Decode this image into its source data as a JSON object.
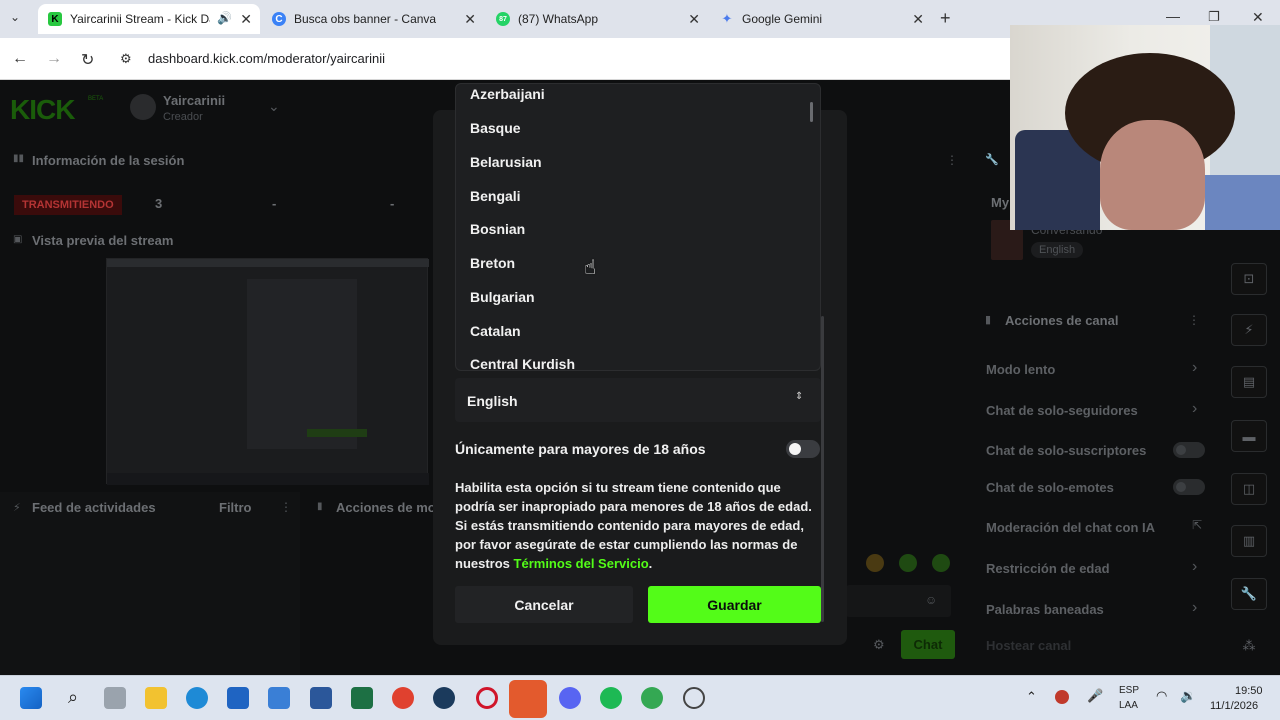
{
  "browser": {
    "tabs": [
      {
        "label": "Yaircarinii Stream - Kick Dashboard",
        "color": "#28c840",
        "glyph": "K"
      },
      {
        "label": "Busca obs banner - Canva",
        "color": "#3b82f6",
        "glyph": "C"
      },
      {
        "label": "(87) WhatsApp",
        "color": "#25d366",
        "glyph": "87"
      },
      {
        "label": "Google Gemini",
        "color": "#ffffff",
        "glyph": "✦"
      }
    ],
    "url": "dashboard.kick.com/moderator/yaircarinii"
  },
  "dashboard": {
    "logo": "KICK",
    "beta": "BETA",
    "channel_name": "Yaircarinii",
    "channel_role": "Creador",
    "session_title": "Información de la sesión",
    "live_badge": "TRANSMITIENDO",
    "viewers": "3",
    "dash1": "-",
    "dash2": "-",
    "preview_title": "Vista previa del stream",
    "feed_title": "Feed de actividades",
    "feed_filter": "Filtro",
    "mod_actions_title": "Acciones de mo",
    "chat_button": "Chat",
    "my_label": "My",
    "stream_category": "Conversando",
    "stream_language": "English",
    "channel_actions_title": "Acciones de canal",
    "channel_actions": [
      {
        "label": "Modo lento",
        "control": "chevron"
      },
      {
        "label": "Chat de solo-seguidores",
        "control": "chevron"
      },
      {
        "label": "Chat de solo-suscriptores",
        "control": "toggle"
      },
      {
        "label": "Chat de solo-emotes",
        "control": "toggle"
      },
      {
        "label": "Moderación del chat con IA",
        "control": "external"
      },
      {
        "label": "Restricción de edad",
        "control": "chevron"
      },
      {
        "label": "Palabras baneadas",
        "control": "chevron"
      },
      {
        "label": "Hostear canal",
        "control": "none"
      }
    ]
  },
  "modal": {
    "language_options": [
      "Azerbaijani",
      "Basque",
      "Belarusian",
      "Bengali",
      "Bosnian",
      "Breton",
      "Bulgarian",
      "Catalan",
      "Central Kurdish"
    ],
    "selected_language": "English",
    "adult_label": "Únicamente para mayores de 18 años",
    "adult_toggle_on": false,
    "adult_description": "Habilita esta opción si tu stream tiene contenido que podría ser inapropiado para menores de 18 años de edad. Si estás transmitiendo contenido para mayores de edad, por favor asegúrate de estar cumpliendo las normas de nuestros",
    "terms_link": "Términos del Servicio",
    "terms_period": ".",
    "cancel_label": "Cancelar",
    "save_label": "Guardar",
    "accent_color": "#53fc18"
  },
  "taskbar": {
    "lang_top": "ESP",
    "lang_bottom": "LAA",
    "time": "19:50",
    "date": "11/1/2026"
  }
}
